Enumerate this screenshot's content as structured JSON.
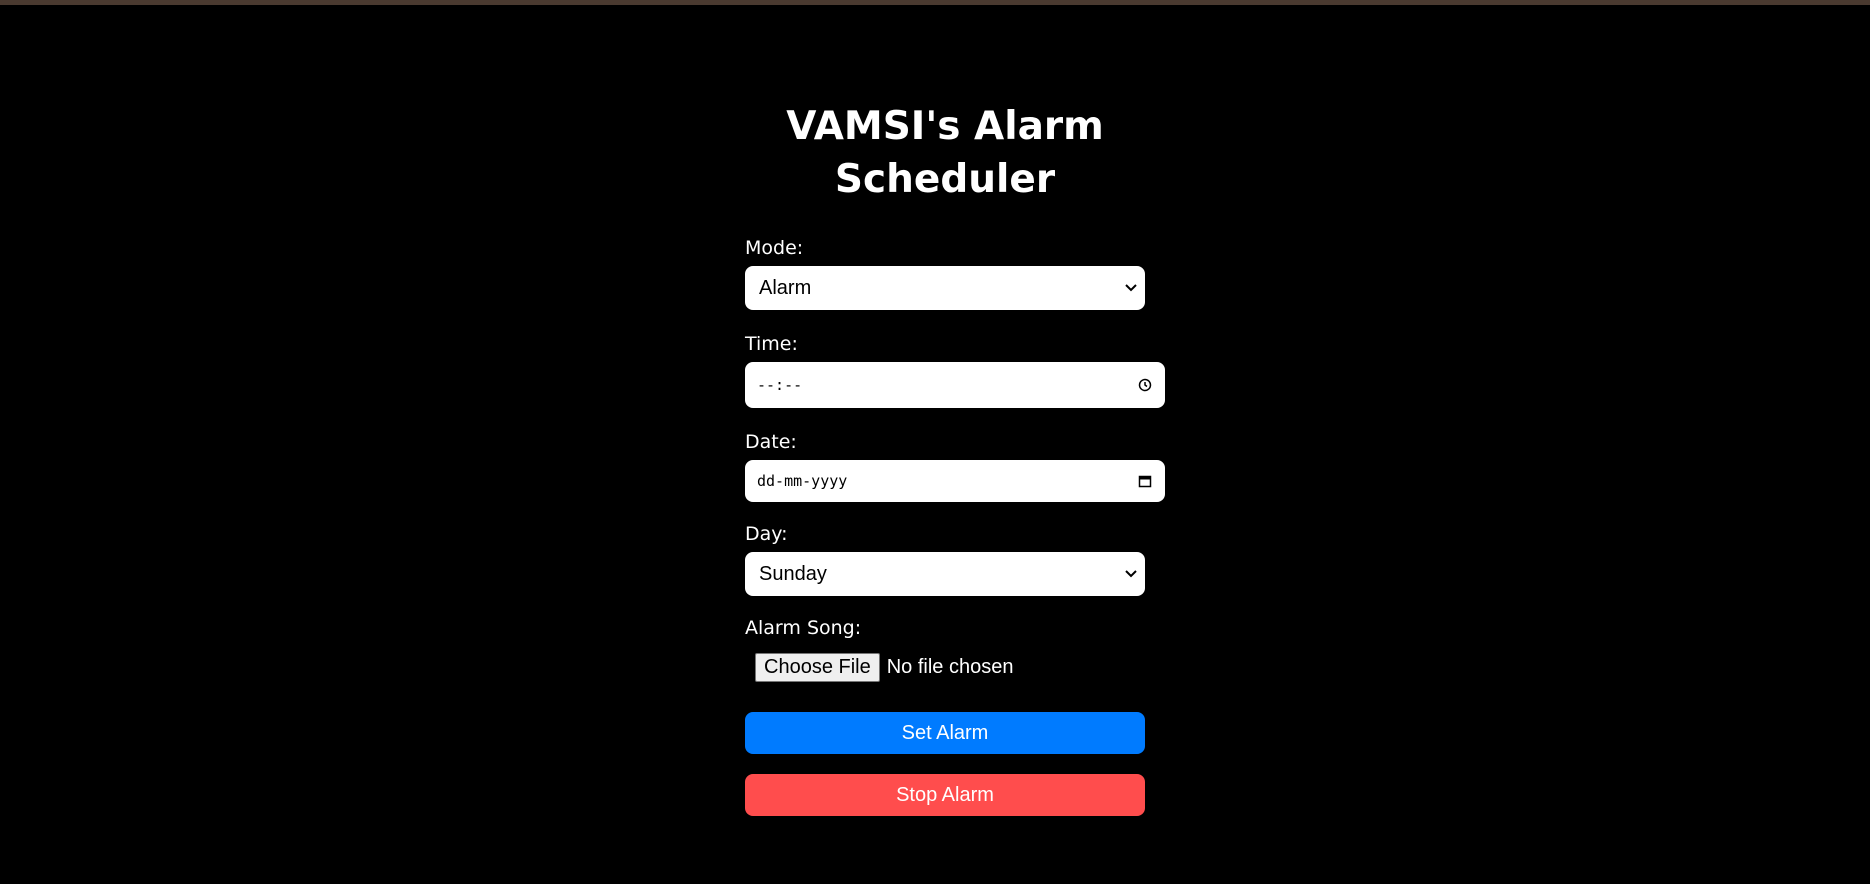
{
  "page": {
    "title": "VAMSI's Alarm Scheduler"
  },
  "form": {
    "mode": {
      "label": "Mode:",
      "value": "Alarm",
      "icon": "chevron-down-icon"
    },
    "time": {
      "label": "Time:",
      "placeholder": "--:--",
      "icon": "clock-icon"
    },
    "date": {
      "label": "Date:",
      "placeholder": "dd-mm-yyyy",
      "icon": "calendar-icon"
    },
    "day": {
      "label": "Day:",
      "value": "Sunday",
      "icon": "chevron-down-icon"
    },
    "song": {
      "label": "Alarm Song:",
      "button_label": "Choose File",
      "status": "No file chosen"
    }
  },
  "actions": {
    "set_label": "Set Alarm",
    "stop_label": "Stop Alarm"
  },
  "colors": {
    "background": "#000000",
    "set_button": "#007bff",
    "stop_button": "#ff4d4d",
    "top_strip": "#4a3a30"
  }
}
